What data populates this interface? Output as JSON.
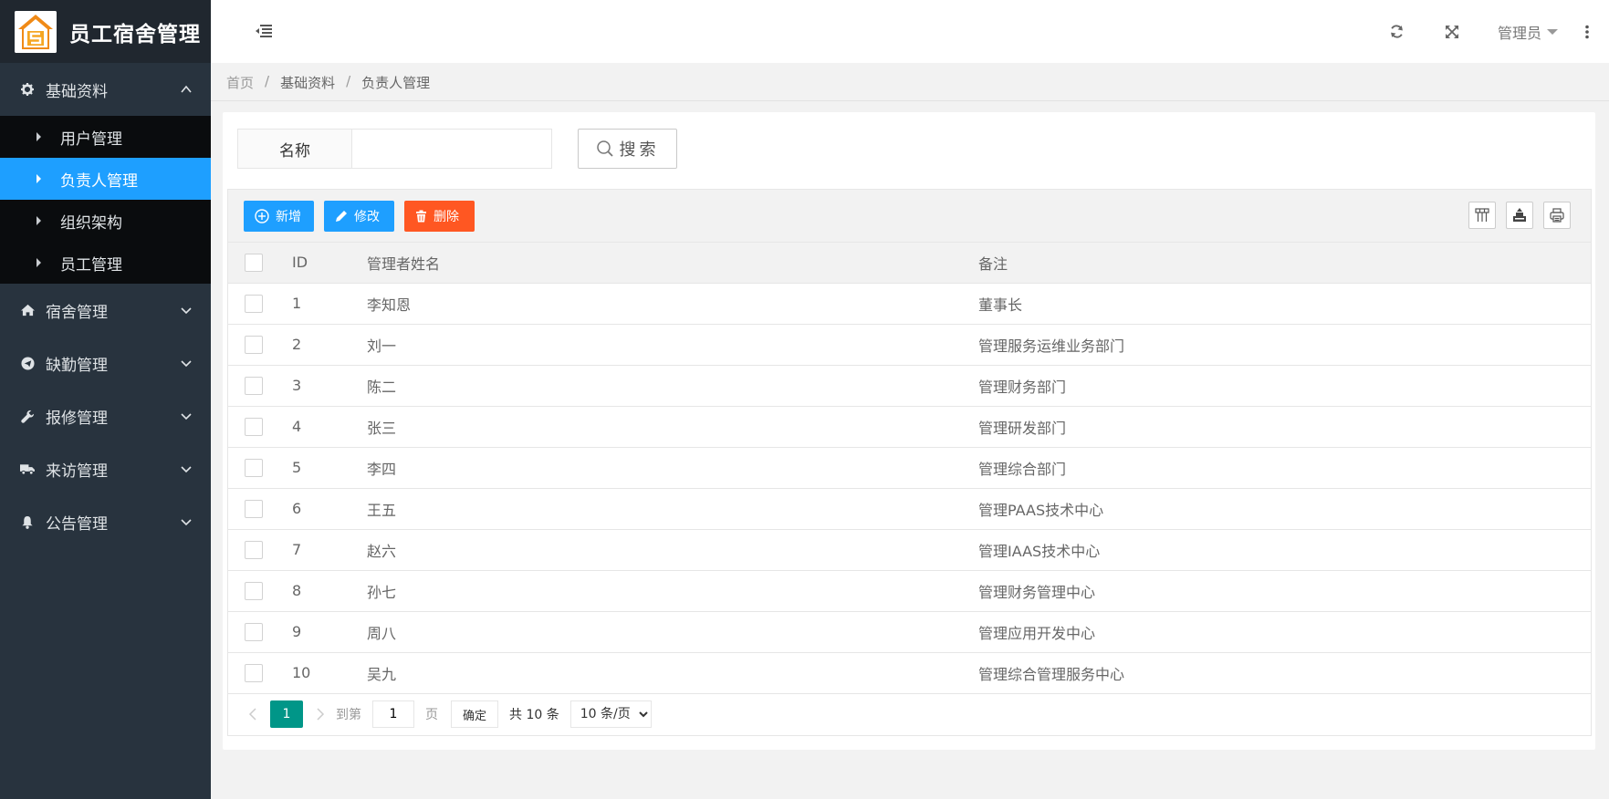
{
  "app": {
    "title": "员工宿舍管理"
  },
  "sidebar": {
    "groups": [
      {
        "label": "基础资料",
        "icon": "gear-icon",
        "expanded": true,
        "items": [
          {
            "label": "用户管理",
            "active": false
          },
          {
            "label": "负责人管理",
            "active": true
          },
          {
            "label": "组织架构",
            "active": false
          },
          {
            "label": "员工管理",
            "active": false
          }
        ]
      },
      {
        "label": "宿舍管理",
        "icon": "home-icon",
        "expanded": false
      },
      {
        "label": "缺勤管理",
        "icon": "send-icon",
        "expanded": false
      },
      {
        "label": "报修管理",
        "icon": "wrench-icon",
        "expanded": false
      },
      {
        "label": "来访管理",
        "icon": "truck-icon",
        "expanded": false
      },
      {
        "label": "公告管理",
        "icon": "bell-icon",
        "expanded": false
      }
    ]
  },
  "header": {
    "user": "管理员"
  },
  "breadcrumb": [
    "首页",
    "基础资料",
    "负责人管理"
  ],
  "search": {
    "label": "名称",
    "value": "",
    "placeholder": "",
    "button": "搜索"
  },
  "toolbar": {
    "add": "新增",
    "edit": "修改",
    "delete": "删除"
  },
  "table": {
    "columns": [
      "ID",
      "管理者姓名",
      "备注"
    ],
    "rows": [
      {
        "id": "1",
        "name": "李知恩",
        "remark": "董事长"
      },
      {
        "id": "2",
        "name": "刘一",
        "remark": "管理服务运维业务部门"
      },
      {
        "id": "3",
        "name": "陈二",
        "remark": "管理财务部门"
      },
      {
        "id": "4",
        "name": "张三",
        "remark": "管理研发部门"
      },
      {
        "id": "5",
        "name": "李四",
        "remark": "管理综合部门"
      },
      {
        "id": "6",
        "name": "王五",
        "remark": "管理PAAS技术中心"
      },
      {
        "id": "7",
        "name": "赵六",
        "remark": "管理IAAS技术中心"
      },
      {
        "id": "8",
        "name": "孙七",
        "remark": "管理财务管理中心"
      },
      {
        "id": "9",
        "name": "周八",
        "remark": "管理应用开发中心"
      },
      {
        "id": "10",
        "name": "吴九",
        "remark": "管理综合管理服务中心"
      }
    ]
  },
  "pager": {
    "current": "1",
    "goto_prefix": "到第",
    "goto_value": "1",
    "goto_suffix": "页",
    "confirm": "确定",
    "total": "共 10 条",
    "page_size": "10 条/页"
  },
  "colors": {
    "sidebar_bg": "#28333e",
    "logo_bg": "#20272f",
    "active": "#1e9fff",
    "danger": "#ff5722",
    "pager_active": "#009688"
  }
}
